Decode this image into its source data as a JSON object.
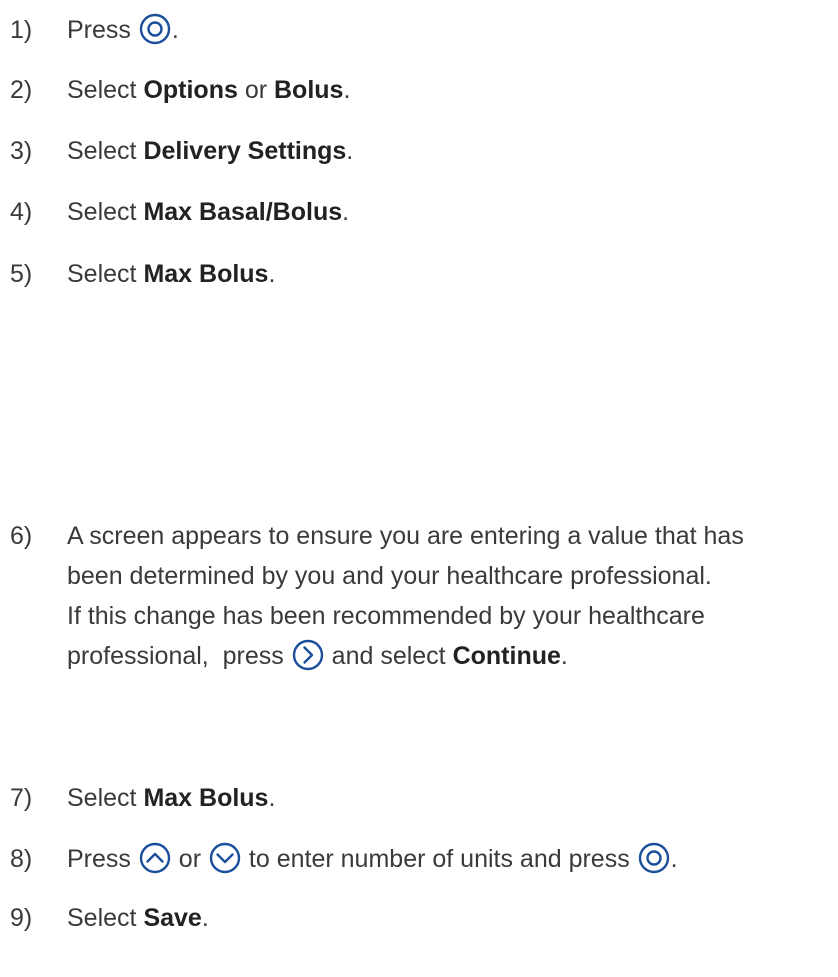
{
  "steps": [
    {
      "number": "1)",
      "parts": [
        "Press ",
        "."
      ],
      "icon": "select-circle-icon"
    },
    {
      "number": "2)",
      "prefix": "Select ",
      "bold1": "Options",
      "mid": " or ",
      "bold2": "Bolus",
      "suffix": "."
    },
    {
      "number": "3)",
      "prefix": "Select ",
      "bold": "Delivery Settings",
      "suffix": "."
    },
    {
      "number": "4)",
      "prefix": "Select ",
      "bold": "Max Basal/Bolus",
      "suffix": "."
    },
    {
      "number": "5)",
      "prefix": "Select ",
      "bold": "Max Bolus",
      "suffix": "."
    },
    {
      "number": "6)",
      "line1": "A screen appears to ensure you are entering a value that has",
      "line2": "been determined by you and your healthcare professional.",
      "line3": "If this change has been recommended by your healthcare",
      "line4_prefix": "professional,  press ",
      "line4_mid": " and select ",
      "line4_bold": "Continue",
      "line4_suffix": ".",
      "icon": "right-arrow-circle-icon"
    },
    {
      "number": "7)",
      "prefix": "Select ",
      "bold": "Max Bolus",
      "suffix": "."
    },
    {
      "number": "8)",
      "prefix": "Press ",
      "or": " or ",
      "middle": " to enter number of units and press ",
      "suffix": ".",
      "icons": [
        "up-arrow-circle-icon",
        "down-arrow-circle-icon",
        "select-circle-icon"
      ]
    },
    {
      "number": "9)",
      "prefix": "Select ",
      "bold": "Save",
      "suffix": "."
    }
  ],
  "colors": {
    "text": "#3a3a3a",
    "bold": "#222222",
    "icon": "#1b4f9c"
  }
}
